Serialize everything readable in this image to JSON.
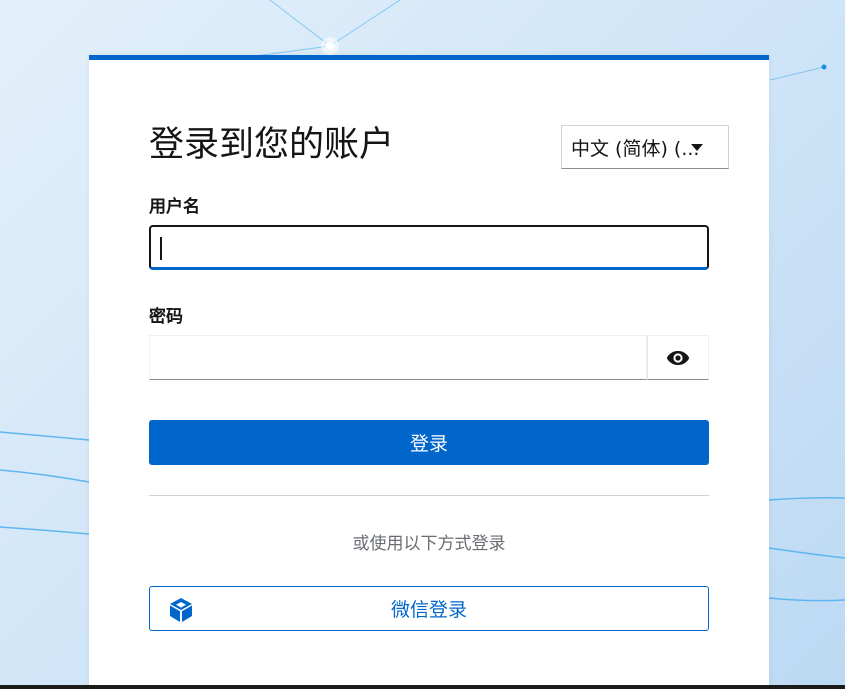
{
  "theme": {
    "accent": "#0066cc",
    "text": "#151515",
    "muted": "#6a6e73"
  },
  "login": {
    "title": "登录到您的账户",
    "language_select": {
      "selected": "中文 (简体) (..."
    },
    "username": {
      "label": "用户名",
      "value": ""
    },
    "password": {
      "label": "密码",
      "value": "",
      "toggle_icon": "eye-icon"
    },
    "submit_label": "登录",
    "alternative_text": "或使用以下方式登录",
    "wechat": {
      "label": "微信登录",
      "icon": "cube-icon"
    }
  }
}
